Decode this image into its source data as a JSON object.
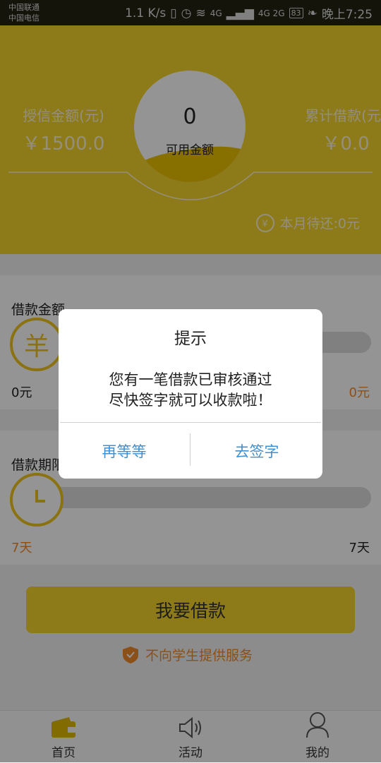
{
  "status_bar": {
    "carrier1": "中国联通",
    "carrier2": "中国电信",
    "speed": "1.1 K/s",
    "signal1": "4G",
    "signal2": "4G 2G",
    "battery": "83",
    "time": "晚上7:25"
  },
  "header": {
    "credit_label": "授信金额(元)",
    "credit_value": "￥1500.0",
    "available_amount": "0",
    "available_label": "可用金额",
    "total_label": "累计借款(元)",
    "total_value": "￥0.0",
    "monthly_icon_glyph": "￥",
    "monthly_due": "本月待还:0元"
  },
  "loan_amount": {
    "title": "借款金额",
    "thumb_glyph": "羊",
    "min": "0元",
    "max": "0元"
  },
  "loan_term": {
    "title": "借款期限",
    "min": "7天",
    "max": "7天"
  },
  "apply_button": "我要借款",
  "notice": "不向学生提供服务",
  "bottom_nav": [
    {
      "label": "首页",
      "icon": "wallet-icon",
      "active": true
    },
    {
      "label": "活动",
      "icon": "speaker-icon",
      "active": false
    },
    {
      "label": "我的",
      "icon": "user-icon",
      "active": false
    }
  ],
  "dialog": {
    "title": "提示",
    "message_line1": "您有一笔借款已审核通过",
    "message_line2": "尽快签字就可以收款啦！",
    "cancel_label": "再等等",
    "confirm_label": "去签字"
  },
  "colors": {
    "brand_yellow": "#f3d22c",
    "accent_orange": "#f08a2a",
    "link_blue": "#3f8fd1"
  }
}
